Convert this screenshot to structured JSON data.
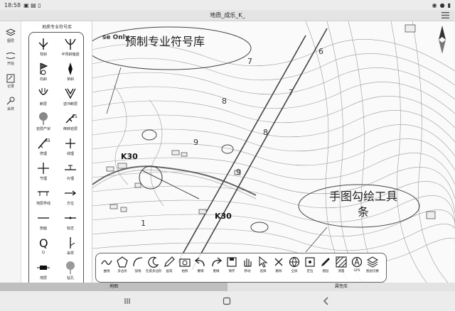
{
  "status": {
    "time": "18:58"
  },
  "title": "地质_成乐_K_",
  "sidebar": {
    "items": [
      {
        "label": "图层",
        "icon": "layers-icon"
      },
      {
        "label": "开始",
        "icon": "start-icon"
      },
      {
        "label": "记录",
        "icon": "record-icon"
      },
      {
        "label": "采样",
        "icon": "sample-icon"
      }
    ]
  },
  "panel": {
    "title": "地质专业符号库",
    "symbols": [
      "背斜",
      "半背斜轴迹",
      "向斜",
      "单斜",
      "断层",
      "逆冲断层",
      "岩层产状",
      "倒转岩层",
      "劈理",
      "线理",
      "节理",
      "片理",
      "地层界线",
      "方位",
      "剖面",
      "标志",
      "Q",
      "采样",
      "地层",
      "钻孔"
    ]
  },
  "map": {
    "watermark": "se Only",
    "callout_library": "预制专业符号库",
    "callout_tools": "手图勾绘工具条",
    "parcel_numbers": [
      "7",
      "8",
      "9",
      "1",
      "8",
      "7",
      "9",
      "6"
    ],
    "k_markers": [
      "K30",
      "K30"
    ]
  },
  "tools": [
    "曲线",
    "多边形",
    "弧线",
    "任意多边形",
    "画笔",
    "拍照",
    "撤销",
    "重做",
    "保存",
    "移动",
    "选择",
    "删除",
    "全屏",
    "定位",
    "图层",
    "测量",
    "GPS",
    "图层切换"
  ],
  "bottom_tabs": [
    "地图",
    "属性库"
  ],
  "colors": {
    "outline": "#555555",
    "map_bg": "#fafafa"
  }
}
